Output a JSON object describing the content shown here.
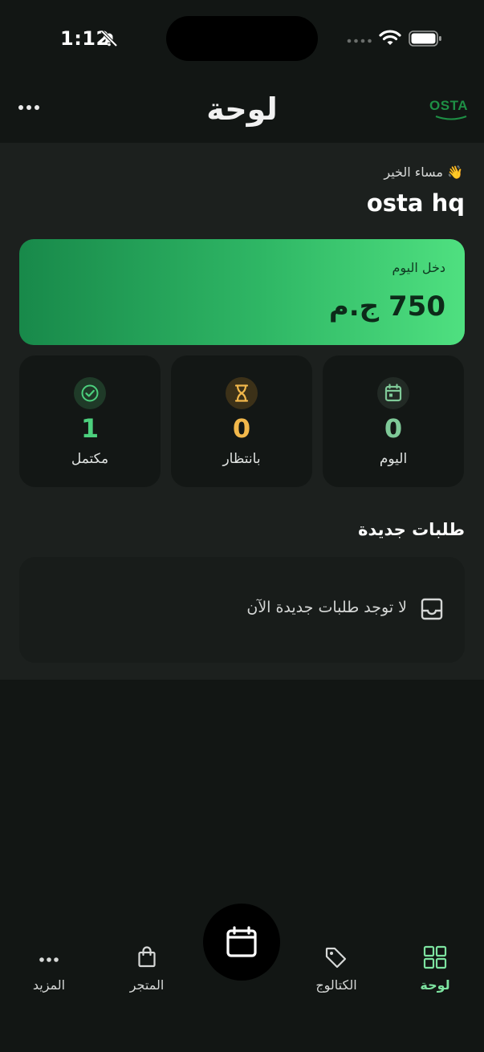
{
  "status_bar": {
    "time": "1:12"
  },
  "header": {
    "title": "لوحة",
    "logo": "OSTA"
  },
  "greeting": {
    "text": "👋 مساء الخير",
    "name": "osta hq"
  },
  "income": {
    "label": "دخل اليوم",
    "value": "750 ج.م"
  },
  "stats": [
    {
      "value": "1",
      "label": "مكتمل",
      "color": "#4cd07d",
      "icon": "check-circle-icon"
    },
    {
      "value": "0",
      "label": "بانتظار",
      "color": "#f2b84b",
      "icon": "hourglass-icon"
    },
    {
      "value": "0",
      "label": "اليوم",
      "color": "#7fc998",
      "icon": "calendar-icon"
    }
  ],
  "new_orders": {
    "title": "طلبات جديدة",
    "empty_text": "لا توجد طلبات جديدة الآن"
  },
  "nav": {
    "more": "المزيد",
    "store": "المتجر",
    "catalog": "الكتالوج",
    "dashboard": "لوحة"
  },
  "colors": {
    "accent": "#4cd07d",
    "background": "#121614",
    "card": "#131715",
    "active_nav": "#7de3a0"
  }
}
